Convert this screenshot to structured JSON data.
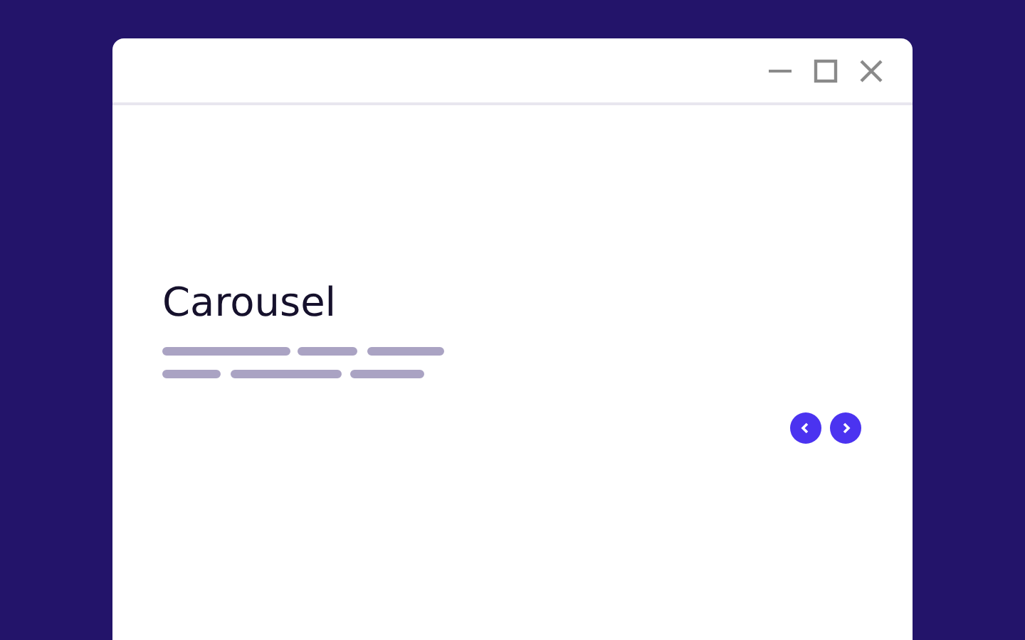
{
  "heading": "Carousel",
  "nav_buttons": [
    {
      "kind": "previous"
    },
    {
      "kind": "next"
    }
  ]
}
